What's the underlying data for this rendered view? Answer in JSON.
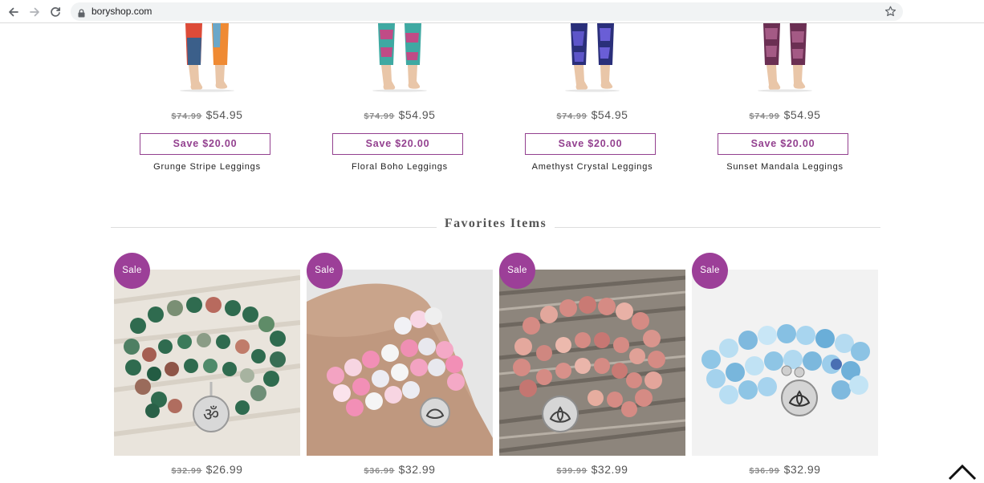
{
  "browser": {
    "url": "boryshop.com",
    "icons": [
      "back-icon",
      "forward-icon",
      "reload-icon",
      "lock-icon",
      "star-icon"
    ]
  },
  "colors": {
    "accent": "#93408f",
    "sale_badge": "#9c3f98",
    "old_price": "#8a8a8a",
    "new_price": "#555555"
  },
  "top_products": [
    {
      "old_price": "$74.99",
      "new_price": "$54.95",
      "save_label": "Save $20.00",
      "name": "Grunge Stripe Leggings"
    },
    {
      "old_price": "$74.99",
      "new_price": "$54.95",
      "save_label": "Save $20.00",
      "name": "Floral Boho Leggings"
    },
    {
      "old_price": "$74.99",
      "new_price": "$54.95",
      "save_label": "Save $20.00",
      "name": "Amethyst Crystal Leggings"
    },
    {
      "old_price": "$74.99",
      "new_price": "$54.95",
      "save_label": "Save $20.00",
      "name": "Sunset Mandala Leggings"
    }
  ],
  "favorites": {
    "title": "Favorites Items",
    "items": [
      {
        "badge": "Sale",
        "old_price": "$32.99",
        "new_price": "$26.99"
      },
      {
        "badge": "Sale",
        "old_price": "$36.99",
        "new_price": "$32.99"
      },
      {
        "badge": "Sale",
        "old_price": "$39.99",
        "new_price": "$32.99"
      },
      {
        "badge": "Sale",
        "old_price": "$36.99",
        "new_price": "$32.99"
      }
    ]
  },
  "back_to_top_icon": "chevron-up-icon"
}
